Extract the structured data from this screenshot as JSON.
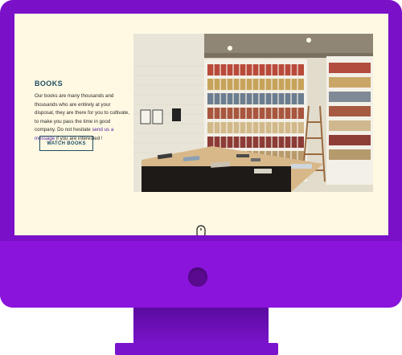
{
  "section": {
    "title": "BOOKS",
    "body_prefix": "Our books are many thousands and thousands who are entirely at your disposal, they are there for you to cultivate, to make you pass the time in good company. Do not hesitate ",
    "link_text": "send us a message",
    "body_suffix": " if you are interested !",
    "button_label": "WATCH BOOKS"
  },
  "colors": {
    "monitor": "#7a10c8",
    "screen_bg": "#fff9e3",
    "heading": "#1e4d63",
    "link": "#4b1fa3"
  },
  "icons": {
    "scroll": "mouse-scroll-icon",
    "power": "power-button-icon"
  }
}
